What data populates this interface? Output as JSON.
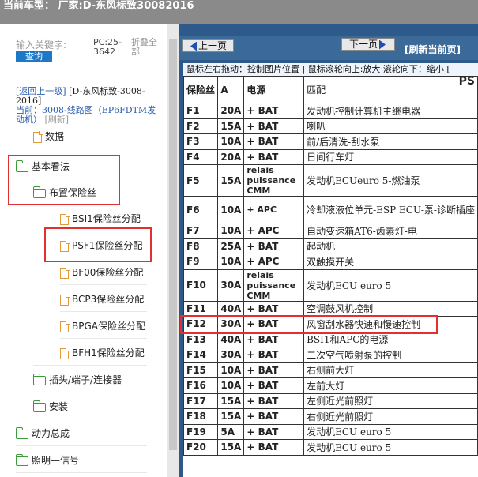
{
  "header": {
    "title": "当前车型：  厂家:D-东风标致30082016"
  },
  "search": {
    "keyword_label": "输入关键字:",
    "query_button": "查询",
    "pc_label": "PC:25-3642",
    "fold_all": "折叠全部"
  },
  "nav": {
    "back_link": "[返回上一级]",
    "model_text": "[D-东风标致-3008-2016]",
    "current_label": "当前：",
    "current_path": "3008-线路图（EP6FDTM发动机）",
    "refresh": "[刷新]"
  },
  "tree": [
    {
      "label": "数据",
      "type": "doc"
    },
    {
      "label": "基本看法",
      "type": "folder"
    },
    {
      "label": "布置保险丝",
      "type": "folder"
    },
    {
      "label": "BSI1保险丝分配",
      "type": "doc"
    },
    {
      "label": "PSF1保险丝分配",
      "type": "doc"
    },
    {
      "label": "BF00保险丝分配",
      "type": "doc"
    },
    {
      "label": "BCP3保险丝分配",
      "type": "doc"
    },
    {
      "label": "BPGA保险丝分配",
      "type": "doc"
    },
    {
      "label": "BFH1保险丝分配",
      "type": "doc"
    },
    {
      "label": "插头/端子/连接器",
      "type": "folder"
    },
    {
      "label": "安装",
      "type": "folder"
    },
    {
      "label": "动力总成",
      "type": "folder"
    },
    {
      "label": "照明—信号",
      "type": "folder"
    }
  ],
  "viewer": {
    "prev_button": "上一页",
    "next_button": "下一页",
    "refresh_button": "[刷新当前页]",
    "hint": "鼠标左右拖动：控制图片位置 | 鼠标滚轮向上:放大  滚轮向下：缩小  [",
    "page_code": "PS"
  },
  "fuse_table": {
    "headers": [
      "保险丝",
      "A",
      "电源",
      "匹配"
    ],
    "rows": [
      [
        "F1",
        "20A",
        "+ BAT",
        "发动机控制计算机主继电器"
      ],
      [
        "F2",
        "15A",
        "+ BAT",
        "喇叭"
      ],
      [
        "F3",
        "10A",
        "+ BAT",
        "前/后清洗-刮水泵"
      ],
      [
        "F4",
        "20A",
        "+ BAT",
        "日间行车灯"
      ],
      [
        "F5",
        "15A",
        "relais puissance CMM",
        "发动机ECUeuro 5-燃油泵"
      ],
      [
        "F6",
        "10A",
        "+ APC",
        "冷却液液位单元-ESP ECU-泵-诊断插座"
      ],
      [
        "F7",
        "10A",
        "+ APC",
        "自动变速箱AT6-齿素灯-电"
      ],
      [
        "F8",
        "25A",
        "+ BAT",
        "起动机"
      ],
      [
        "F9",
        "10A",
        "+ APC",
        "双触摸开关"
      ],
      [
        "F10",
        "30A",
        "relais puissance CMM",
        "发动机ECU euro 5"
      ],
      [
        "F11",
        "40A",
        "+ BAT",
        "空调鼓风机控制"
      ],
      [
        "F12",
        "30A",
        "+ BAT",
        "风窗刮水器快速和慢速控制"
      ],
      [
        "F13",
        "40A",
        "+ BAT",
        "BSI1和APC的电源"
      ],
      [
        "F14",
        "30A",
        "+ BAT",
        "二次空气喷射泵的控制"
      ],
      [
        "F15",
        "10A",
        "+ BAT",
        "右侧前大灯"
      ],
      [
        "F16",
        "10A",
        "+ BAT",
        "左前大灯"
      ],
      [
        "F17",
        "15A",
        "+ BAT",
        "左侧近光前照灯"
      ],
      [
        "F18",
        "15A",
        "+ BAT",
        "右侧近光前照灯"
      ],
      [
        "F19",
        "5A",
        "+ BAT",
        "发动机ECU euro 5"
      ],
      [
        "F20",
        "15A",
        "+ BAT",
        "发动机ECU euro 5"
      ]
    ]
  },
  "colors": {
    "highlight": "#e03030",
    "viewer_bg": "#2d5a8a",
    "button_blue": "#1e78c8"
  }
}
